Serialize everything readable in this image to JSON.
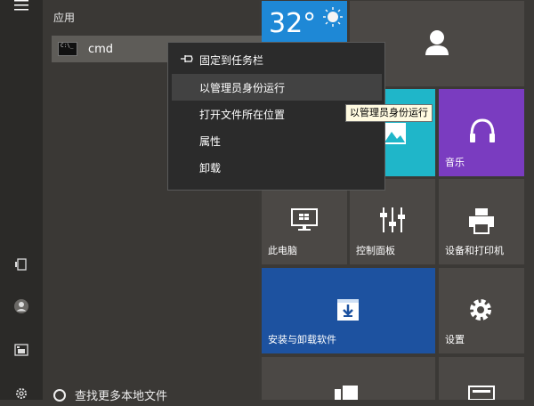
{
  "left_rail": {
    "menu_icon": "hamburger-menu-icon",
    "items": [
      {
        "name": "tablet-mode-icon"
      },
      {
        "name": "user-icon"
      },
      {
        "name": "pictures-icon"
      },
      {
        "name": "settings-icon"
      }
    ]
  },
  "apps": {
    "section_title": "应用",
    "items": [
      {
        "label": "cmd",
        "icon": "command-prompt-icon"
      }
    ]
  },
  "context_menu": {
    "items": [
      {
        "label": "固定到任务栏",
        "icon": "pin-icon"
      },
      {
        "label": "以管理员身份运行",
        "hovered": true
      },
      {
        "label": "打开文件所在位置"
      },
      {
        "label": "属性"
      },
      {
        "label": "卸载"
      }
    ]
  },
  "tooltip": {
    "text": "以管理员身份运行"
  },
  "search": {
    "label": "查找更多本地文件"
  },
  "tiles": {
    "weather": {
      "temp": "32°",
      "color": "#1e88d6"
    },
    "people": {
      "color": "#4b4845"
    },
    "photos": {
      "color": "#1fb6c9"
    },
    "music": {
      "label": "音乐",
      "color": "#7a3cc0"
    },
    "this_pc": {
      "label": "此电脑",
      "color": "#4b4845"
    },
    "control_panel": {
      "label": "控制面板",
      "color": "#4b4845"
    },
    "devices_printers": {
      "label": "设备和打印机",
      "color": "#4b4845"
    },
    "install_uninstall": {
      "label": "安装与卸载软件",
      "color": "#1d52a0"
    },
    "settings": {
      "label": "设置",
      "color": "#4b4845"
    }
  }
}
